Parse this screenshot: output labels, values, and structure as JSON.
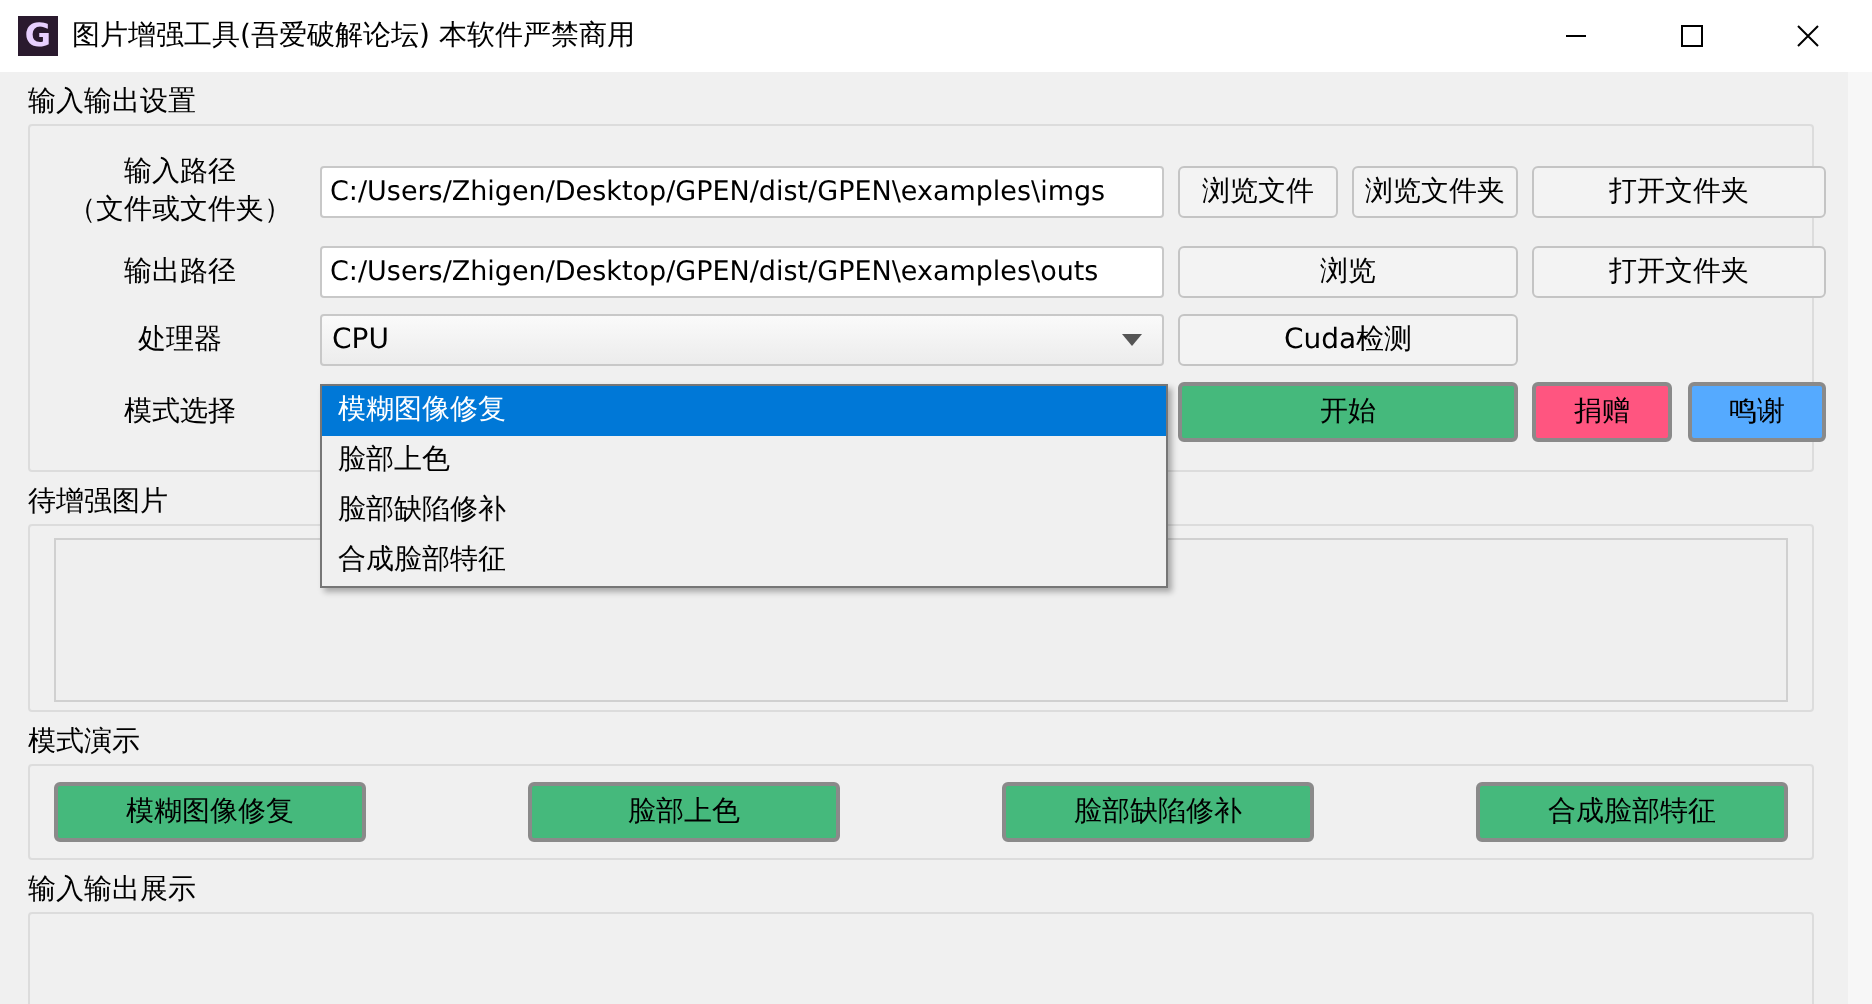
{
  "window": {
    "title": "图片增强工具(吾爱破解论坛) 本软件严禁商用",
    "app_icon_letter": "G"
  },
  "settings": {
    "title": "输入输出设置",
    "input_path": {
      "label": "输入路径",
      "sublabel": "（文件或文件夹）",
      "value": "C:/Users/Zhigen/Desktop/GPEN/dist/GPEN\\examples\\imgs",
      "buttons": [
        "浏览文件",
        "浏览文件夹",
        "打开文件夹"
      ]
    },
    "output_path": {
      "label": "输出路径",
      "value": "C:/Users/Zhigen/Desktop/GPEN/dist/GPEN\\examples\\outs",
      "buttons": [
        "浏览",
        "打开文件夹"
      ]
    },
    "processor": {
      "label": "处理器",
      "value": "CPU",
      "button": "Cuda检测"
    },
    "mode": {
      "label": "模式选择",
      "expanded": true,
      "options": [
        {
          "label": "模糊图像修复",
          "selected": true
        },
        {
          "label": "脸部上色",
          "selected": false
        },
        {
          "label": "脸部缺陷修补",
          "selected": false
        },
        {
          "label": "合成脸部特征",
          "selected": false
        }
      ]
    },
    "actions": [
      {
        "label": "开始",
        "color": "#45b97c"
      },
      {
        "label": "捐赠",
        "color": "#ff5580"
      },
      {
        "label": "鸣谢",
        "color": "#55aaff"
      }
    ]
  },
  "pending": {
    "title": "待增强图片"
  },
  "demo": {
    "title": "模式演示",
    "buttons": [
      "模糊图像修复",
      "脸部上色",
      "脸部缺陷修补",
      "合成脸部特征"
    ]
  },
  "display": {
    "title": "输入输出展示"
  }
}
